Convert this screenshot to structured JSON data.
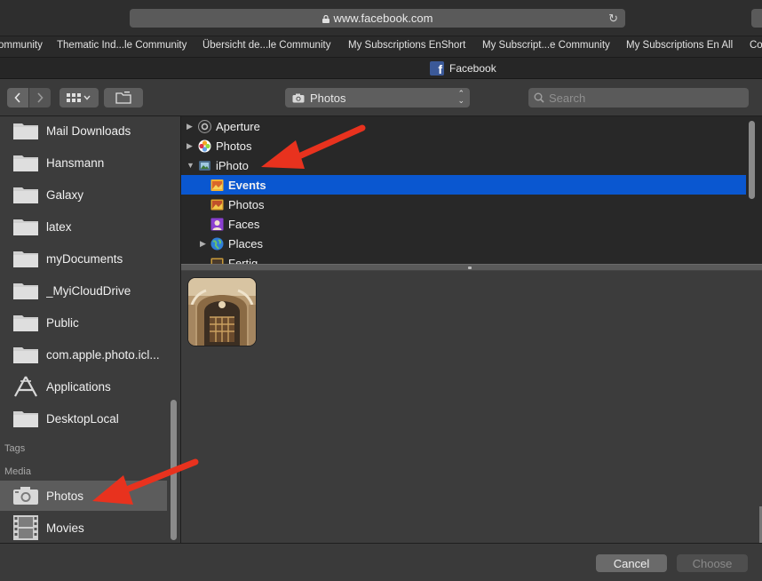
{
  "browser": {
    "url": "www.facebook.com",
    "bookmarks": [
      "ommunity",
      "Thematic Ind...le Community",
      "Übersicht de...le Community",
      "My Subscriptions EnShort",
      "My Subscript...e Community",
      "My Subscriptions En All",
      "Co"
    ],
    "tab_title": "Facebook",
    "tab_icon_letter": "f"
  },
  "toolbar": {
    "location": "Photos",
    "search_placeholder": "Search"
  },
  "sidebar": {
    "items": [
      {
        "label": "Mail Downloads",
        "icon": "folder-icon"
      },
      {
        "label": "Hansmann",
        "icon": "folder-icon"
      },
      {
        "label": "Galaxy",
        "icon": "folder-icon"
      },
      {
        "label": "latex",
        "icon": "folder-icon"
      },
      {
        "label": "myDocuments",
        "icon": "folder-icon"
      },
      {
        "label": "_MyiCloudDrive",
        "icon": "folder-icon"
      },
      {
        "label": "Public",
        "icon": "folder-icon"
      },
      {
        "label": "com.apple.photo.icl...",
        "icon": "folder-icon"
      },
      {
        "label": "Applications",
        "icon": "applications-icon"
      },
      {
        "label": "DesktopLocal",
        "icon": "folder-icon"
      }
    ],
    "tags_header": "Tags",
    "media_header": "Media",
    "media_items": [
      {
        "label": "Photos",
        "icon": "camera-icon",
        "selected": true
      },
      {
        "label": "Movies",
        "icon": "film-icon",
        "selected": false
      }
    ]
  },
  "library_browser": {
    "rows": [
      {
        "label": "Aperture",
        "icon": "aperture-icon",
        "disclosure": "collapsed",
        "level": 0
      },
      {
        "label": "Photos",
        "icon": "photos-app-icon",
        "disclosure": "collapsed",
        "level": 0
      },
      {
        "label": "iPhoto",
        "icon": "iphoto-icon",
        "disclosure": "expanded",
        "level": 0
      },
      {
        "label": "Events",
        "icon": "events-icon",
        "disclosure": "none",
        "level": 1,
        "selected": true
      },
      {
        "label": "Photos",
        "icon": "photos-album-icon",
        "disclosure": "none",
        "level": 1
      },
      {
        "label": "Faces",
        "icon": "faces-icon",
        "disclosure": "none",
        "level": 1
      },
      {
        "label": "Places",
        "icon": "places-icon",
        "disclosure": "collapsed",
        "level": 1
      },
      {
        "label": "Fertig",
        "icon": "album-icon",
        "disclosure": "none",
        "level": 1
      }
    ]
  },
  "footer": {
    "cancel_label": "Cancel",
    "choose_label": "Choose"
  },
  "colors": {
    "selection": "#0a57d0",
    "annotation_arrow": "#e8321e"
  }
}
